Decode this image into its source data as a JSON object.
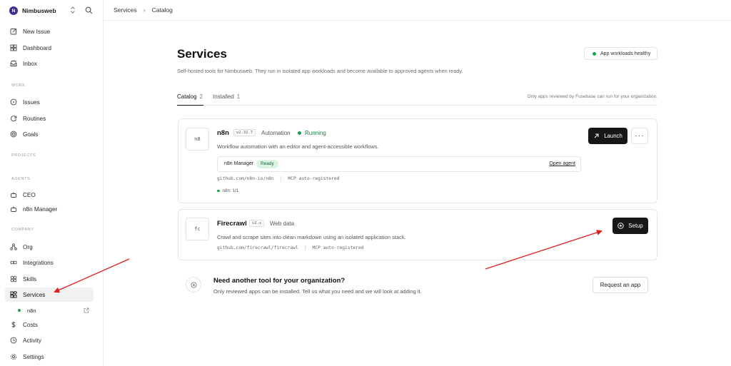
{
  "workspace": {
    "initial": "N",
    "name": "Nimbusweb",
    "chevron": "⌃⌄"
  },
  "topbar": {
    "crumb1": "Services",
    "sep": "›",
    "crumb2": "Catalog"
  },
  "sidebar": {
    "top": [
      {
        "label": "New Issue",
        "icon": "edit-icon"
      },
      {
        "label": "Dashboard",
        "icon": "dashboard-icon"
      },
      {
        "label": "Inbox",
        "icon": "inbox-icon"
      }
    ],
    "work_label": "WORK",
    "work": [
      {
        "label": "Issues",
        "icon": "issues-icon"
      },
      {
        "label": "Routines",
        "icon": "routines-icon"
      },
      {
        "label": "Goals",
        "icon": "goals-icon"
      }
    ],
    "projects_label": "PROJECTS",
    "agents_label": "AGENTS",
    "agents": [
      {
        "label": "CEO",
        "icon": "bot-icon"
      },
      {
        "label": "n8n Manager",
        "icon": "bot-icon"
      }
    ],
    "company_label": "COMPANY",
    "company": [
      {
        "label": "Org",
        "icon": "org-icon"
      },
      {
        "label": "Integrations",
        "icon": "link-icon"
      },
      {
        "label": "Skills",
        "icon": "skills-icon"
      },
      {
        "label": "Services",
        "icon": "services-icon"
      },
      {
        "label": "n8n",
        "icon": "status-dot"
      },
      {
        "label": "Costs",
        "icon": "dollar-icon"
      },
      {
        "label": "Activity",
        "icon": "activity-icon"
      },
      {
        "label": "Settings",
        "icon": "settings-icon"
      }
    ]
  },
  "main": {
    "title": "Services",
    "subtitle": "Self-hosted tools for Nimbusweb. They run in isolated app workloads and become available to approved agents when ready.",
    "health": "App workloads healthy",
    "tabs": [
      {
        "label": "Catalog",
        "count": "2"
      },
      {
        "label": "Installed",
        "count": "1"
      }
    ],
    "tabs_note": "Only apps reviewed by Fusebase can run for your organization."
  },
  "apps": [
    {
      "icon_text": "n8",
      "name": "n8n",
      "version": "v2.32.7",
      "category": "Automation",
      "status": "Running",
      "description": "Workflow automation with an editor and agent-accessible workflows.",
      "agent": {
        "name": "n8n Manager",
        "state": "Ready",
        "action": "Open agent"
      },
      "repo": "github.com/n8n-io/n8n",
      "mcp": "MCP auto-registered",
      "instances": "n8n: 1/1",
      "primary_action": "Launch",
      "more": "···"
    },
    {
      "icon_text": "fc",
      "name": "Firecrawl",
      "version": "v2.x",
      "category": "Web data",
      "description": "Crawl and scrape sites into clean markdown using an isolated application stack.",
      "repo": "github.com/firecrawl/firecrawl",
      "mcp": "MCP auto-registered",
      "primary_action": "Setup"
    }
  ],
  "request": {
    "title": "Need another tool for your organization?",
    "subtitle": "Only reviewed apps can be installed. Tell us what you need and we will look at adding it.",
    "button": "Request an app"
  },
  "colors": {
    "accent_green": "#16a34a",
    "annotation_red": "#e11d1d",
    "dark_button": "#171717"
  }
}
